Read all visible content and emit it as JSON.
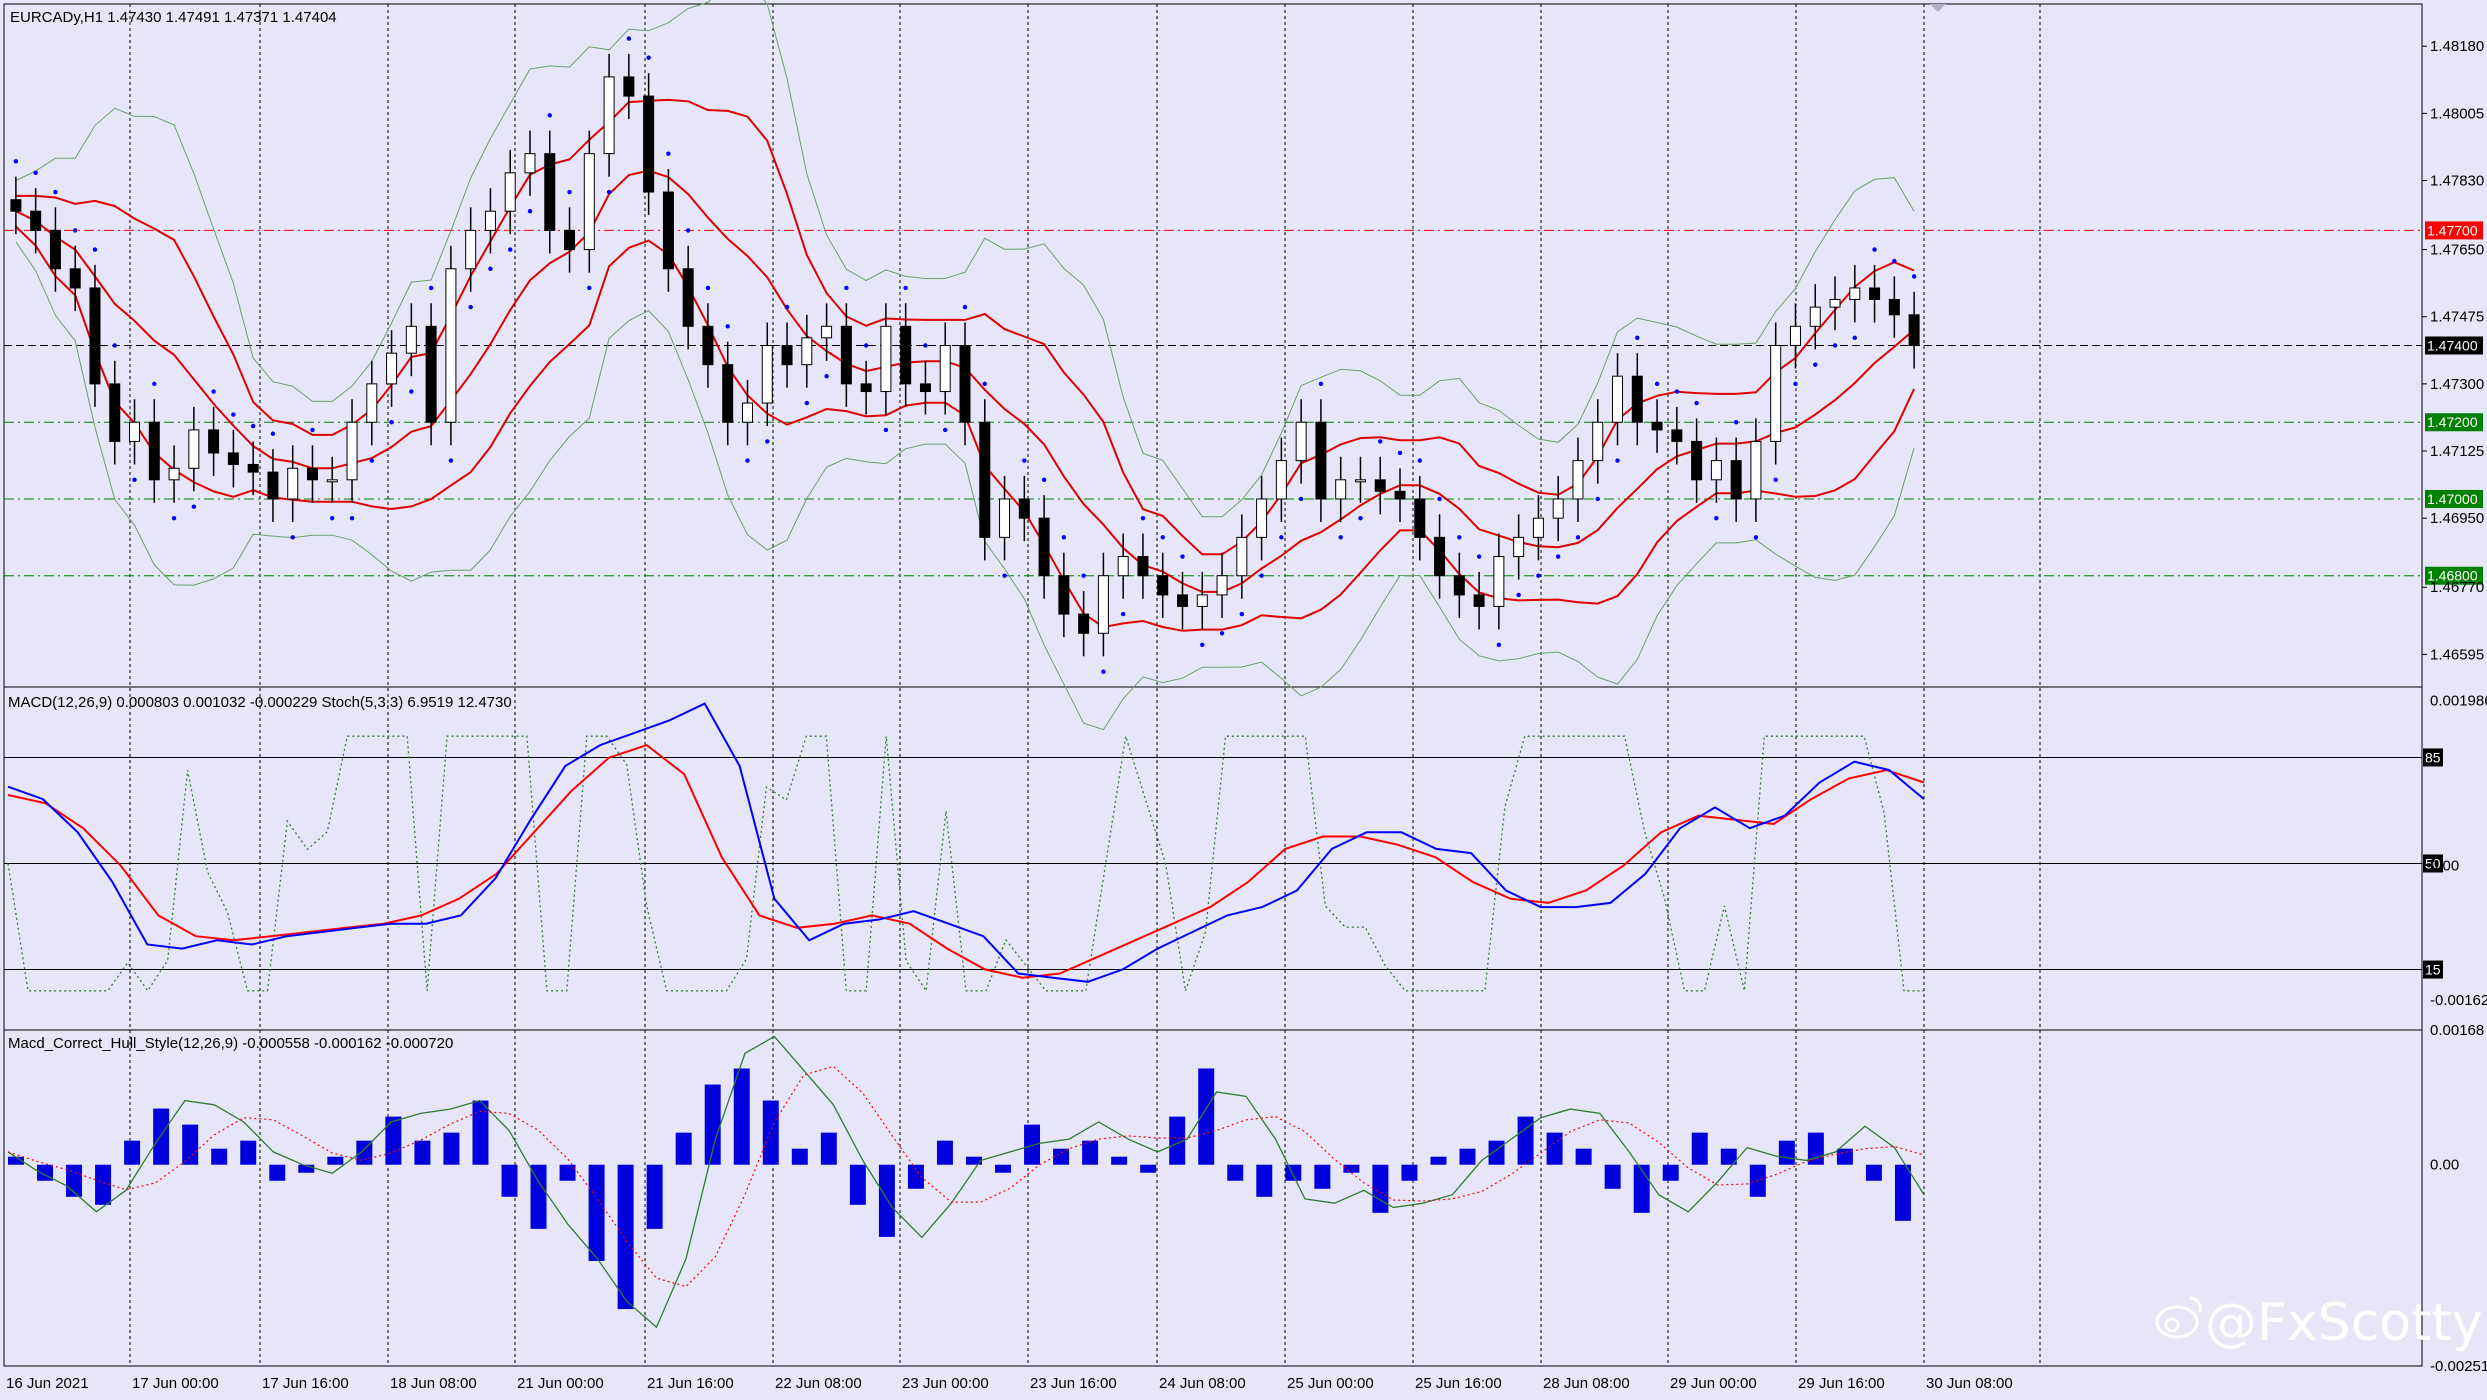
{
  "symbol_info": "EURCADy,H1  1.47430 1.47491 1.47371 1.47404",
  "macd_stoch_info": "MACD(12,26,9) 0.000803 0.001032 -0.000229  Stoch(5,3,3) 6.9519 12.4730",
  "hull_info": "Macd_Correct_Hull_Style(12,26,9) -0.000558 -0.000162 -0.000720",
  "watermark": "@FxScotty",
  "colors": {
    "background": "#e6e6f8",
    "bullish": "#ffffff",
    "bearish": "#000000",
    "bollinger_mid": "#e00000",
    "bollinger_outer": "#6aa06a",
    "parabolic_sar": "#0000ff",
    "macd_line": "#0000ff",
    "signal_line": "#ff0000",
    "stoch": "#2e7d2e",
    "histogram": "#0000dd",
    "resistance": "#ff0000",
    "support": "#008000"
  },
  "chart_data": [
    {
      "type": "candlestick",
      "title": "EURCADy,H1  1.47430 1.47491 1.47371 1.47404",
      "ylim": [
        1.4651,
        1.4829
      ],
      "y_ticks": [
        "1.48180",
        "1.48005",
        "1.47830",
        "1.47650",
        "1.47475",
        "1.47300",
        "1.47125",
        "1.46950",
        "1.46770",
        "1.46595"
      ],
      "x_ticks": [
        "16 Jun 2021",
        "17 Jun 00:00",
        "17 Jun 16:00",
        "18 Jun 08:00",
        "21 Jun 00:00",
        "21 Jun 16:00",
        "22 Jun 08:00",
        "23 Jun 00:00",
        "23 Jun 16:00",
        "24 Jun 08:00",
        "25 Jun 00:00",
        "25 Jun 16:00",
        "28 Jun 08:00",
        "29 Jun 00:00",
        "29 Jun 16:00",
        "30 Jun 08:00"
      ],
      "price_levels": [
        {
          "value": 1.477,
          "label": "1.47700",
          "kind": "resistance"
        },
        {
          "value": 1.474,
          "label": "1.47400",
          "kind": "current"
        },
        {
          "value": 1.472,
          "label": "1.47200",
          "kind": "support"
        },
        {
          "value": 1.47,
          "label": "1.47000",
          "kind": "support"
        },
        {
          "value": 1.468,
          "label": "1.46800",
          "kind": "support"
        }
      ],
      "series": [
        {
          "name": "Close (approx.)",
          "values": [
            1.4775,
            1.477,
            1.476,
            1.4755,
            1.473,
            1.4715,
            1.472,
            1.4705,
            1.4708,
            1.4718,
            1.4712,
            1.4709,
            1.4707,
            1.47,
            1.4708,
            1.4705,
            1.4705,
            1.472,
            1.473,
            1.4738,
            1.4745,
            1.472,
            1.476,
            1.477,
            1.4775,
            1.4785,
            1.479,
            1.477,
            1.4765,
            1.479,
            1.481,
            1.4805,
            1.478,
            1.476,
            1.4745,
            1.4735,
            1.472,
            1.4725,
            1.474,
            1.4735,
            1.4742,
            1.4745,
            1.473,
            1.4728,
            1.4745,
            1.473,
            1.4728,
            1.474,
            1.472,
            1.469,
            1.47,
            1.4695,
            1.468,
            1.467,
            1.4665,
            1.468,
            1.4685,
            1.468,
            1.4675,
            1.4672,
            1.4675,
            1.468,
            1.469,
            1.47,
            1.471,
            1.472,
            1.47,
            1.4705,
            1.4705,
            1.4702,
            1.47,
            1.469,
            1.468,
            1.4675,
            1.4672,
            1.4685,
            1.469,
            1.4695,
            1.47,
            1.471,
            1.472,
            1.4732,
            1.472,
            1.4718,
            1.4715,
            1.4705,
            1.471,
            1.47,
            1.4715,
            1.474,
            1.4745,
            1.475,
            1.4752,
            1.4755,
            1.4752,
            1.4748,
            1.474
          ]
        }
      ]
    },
    {
      "type": "line",
      "title": "MACD(12,26,9) 0.000803 0.001032 -0.000229  Stoch(5,3,3) 6.9519 12.4730",
      "ylim": [
        -0.00198,
        0.00215
      ],
      "y_ticks": [
        "0.001986",
        "0.00",
        "-0.00162"
      ],
      "stoch_levels": [
        "85",
        "50",
        "15"
      ],
      "series": [
        {
          "name": "MACD",
          "values": [
            0.00095,
            0.0008,
            0.0004,
            -0.0002,
            -0.00095,
            -0.001,
            -0.0009,
            -0.00095,
            -0.00085,
            -0.0008,
            -0.00075,
            -0.0007,
            -0.0007,
            -0.0006,
            -0.00015,
            0.00055,
            0.0012,
            0.00145,
            0.0016,
            0.00175,
            0.00195,
            0.0012,
            -0.0004,
            -0.0009,
            -0.0007,
            -0.00065,
            -0.00055,
            -0.0007,
            -0.00085,
            -0.0013,
            -0.00135,
            -0.0014,
            -0.00125,
            -0.001,
            -0.0008,
            -0.0006,
            -0.0005,
            -0.0003,
            0.0002,
            0.0004,
            0.0004,
            0.0002,
            0.00015,
            -0.0003,
            -0.0005,
            -0.0005,
            -0.00045,
            -0.0001,
            0.00045,
            0.0007,
            0.00045,
            0.0006,
            0.001,
            0.00125,
            0.00115,
            0.0008
          ]
        },
        {
          "name": "Signal",
          "values": [
            0.00085,
            0.00075,
            0.00045,
            0.0,
            -0.0006,
            -0.00085,
            -0.0009,
            -0.00085,
            -0.0008,
            -0.00075,
            -0.0007,
            -0.0006,
            -0.0004,
            -0.0001,
            0.0004,
            0.0009,
            0.0013,
            0.00145,
            0.0011,
            0.0001,
            -0.0006,
            -0.00075,
            -0.0007,
            -0.0006,
            -0.0007,
            -0.001,
            -0.00125,
            -0.00135,
            -0.0013,
            -0.0011,
            -0.0009,
            -0.0007,
            -0.0005,
            -0.0002,
            0.0002,
            0.00035,
            0.00035,
            0.00025,
            0.0001,
            -0.0002,
            -0.0004,
            -0.00045,
            -0.0003,
            0.0,
            0.0004,
            0.0006,
            0.00055,
            0.0005,
            0.0008,
            0.00105,
            0.00115,
            0.001
          ]
        }
      ]
    },
    {
      "type": "bar",
      "title": "Macd_Correct_Hull_Style(12,26,9) -0.000558 -0.000162 -0.000720",
      "ylim": [
        -0.00251,
        0.00168
      ],
      "y_ticks": [
        "0.00168",
        "0.00",
        "-0.00251"
      ],
      "series": [
        {
          "name": "Histogram",
          "values": [
            0.0001,
            -0.0002,
            -0.0004,
            -0.0005,
            0.0003,
            0.0007,
            0.0005,
            0.0002,
            0.0003,
            -0.0002,
            -0.0001,
            0.0001,
            0.0003,
            0.0006,
            0.0003,
            0.0004,
            0.0008,
            -0.0004,
            -0.0008,
            -0.0002,
            -0.0012,
            -0.0018,
            -0.0008,
            0.0004,
            0.001,
            0.0012,
            0.0008,
            0.0002,
            0.0004,
            -0.0005,
            -0.0009,
            -0.0003,
            0.0003,
            0.0001,
            -0.0001,
            0.0005,
            0.0002,
            0.0003,
            0.0001,
            -0.0001,
            0.0006,
            0.0012,
            -0.0002,
            -0.0004,
            -0.0002,
            -0.0003,
            -0.0001,
            -0.0006,
            -0.0002,
            0.0001,
            0.0002,
            0.0003,
            0.0006,
            0.0004,
            0.0002,
            -0.0003,
            -0.0006,
            -0.0002,
            0.0004,
            0.0002,
            -0.0004,
            0.0003,
            0.0004,
            0.0002,
            -0.0002,
            -0.0007
          ]
        }
      ]
    }
  ]
}
